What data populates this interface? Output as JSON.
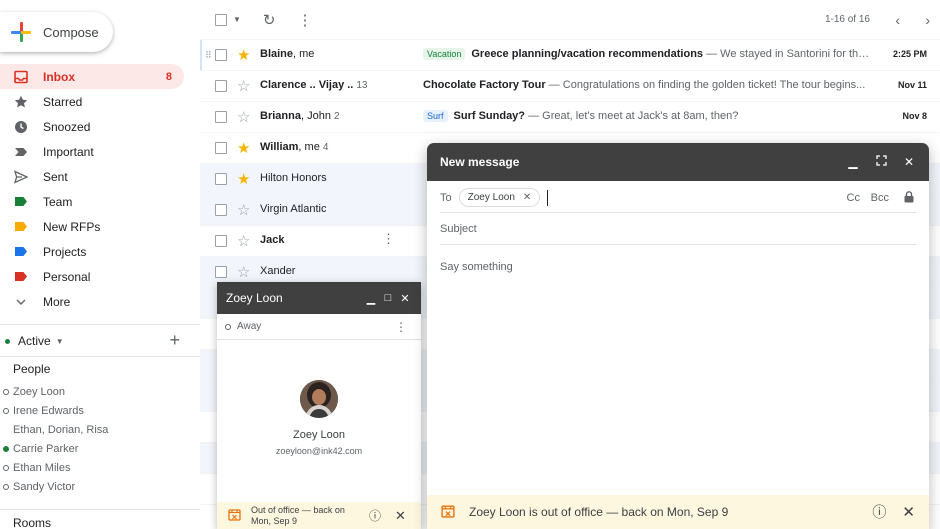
{
  "compose_label": "Compose",
  "nav": [
    {
      "label": "Inbox",
      "count": "8",
      "icon": "inbox-icon",
      "active": true
    },
    {
      "label": "Starred",
      "count": "",
      "icon": "star-icon"
    },
    {
      "label": "Snoozed",
      "count": "",
      "icon": "clock-icon"
    },
    {
      "label": "Important",
      "count": "",
      "icon": "important-icon"
    },
    {
      "label": "Sent",
      "count": "",
      "icon": "send-icon"
    },
    {
      "label": "Team",
      "count": "",
      "icon": "label-icon",
      "color": "#188038"
    },
    {
      "label": "New RFPs",
      "count": "",
      "icon": "label-icon",
      "color": "#f9ab00"
    },
    {
      "label": "Projects",
      "count": "",
      "icon": "label-icon",
      "color": "#1a73e8"
    },
    {
      "label": "Personal",
      "count": "",
      "icon": "label-icon",
      "color": "#d93025"
    },
    {
      "label": "More",
      "count": "",
      "icon": "chevron-down-icon"
    }
  ],
  "active_label": "Active",
  "people_title": "People",
  "people": [
    {
      "name": "Zoey Loon",
      "status": "away"
    },
    {
      "name": "Irene Edwards",
      "status": "away"
    },
    {
      "name": "Ethan, Dorian, Risa",
      "status": "none"
    },
    {
      "name": "Carrie Parker",
      "status": "online"
    },
    {
      "name": "Ethan Miles",
      "status": "away"
    },
    {
      "name": "Sandy Victor",
      "status": "away"
    }
  ],
  "rooms_label": "Rooms",
  "toolbar": {
    "range": "1-16 of 16"
  },
  "emails": [
    {
      "sender": "Blaine",
      "sender_suffix": ", me",
      "count": "",
      "starred": true,
      "unread": true,
      "label": "Vacation",
      "label_bg": "#e6f4ea",
      "label_fg": "#188038",
      "subject": "Greece planning/vacation recommendations",
      "snippet": " — We stayed in Santorini for the...",
      "date": "2:25 PM"
    },
    {
      "sender": "Clarence .. Vijay ..",
      "sender_suffix": "",
      "count": "13",
      "starred": false,
      "unread": true,
      "label": "",
      "subject": "Chocolate Factory Tour",
      "snippet": " — Congratulations on finding the golden ticket! The tour begins...",
      "date": "Nov 11"
    },
    {
      "sender": "Brianna",
      "sender_suffix": ", John",
      "count": "2",
      "starred": false,
      "unread": true,
      "label": "Surf",
      "label_bg": "#e8f0fe",
      "label_fg": "#1967d2",
      "subject": "Surf Sunday?",
      "snippet": " — Great, let's meet at Jack's at 8am, then?",
      "date": "Nov 8"
    },
    {
      "sender": "William",
      "sender_suffix": ", me",
      "count": "4",
      "starred": true,
      "unread": true,
      "label": "",
      "subject": "",
      "snippet": "",
      "date": ""
    },
    {
      "sender": "Hilton Honors",
      "sender_suffix": "",
      "count": "",
      "starred": true,
      "unread": false,
      "label": "",
      "subject": "",
      "snippet": "",
      "date": ""
    },
    {
      "sender": "Virgin Atlantic",
      "sender_suffix": "",
      "count": "",
      "starred": false,
      "unread": false,
      "label": "",
      "subject": "",
      "snippet": "",
      "date": ""
    },
    {
      "sender": "Jack",
      "sender_suffix": "",
      "count": "",
      "starred": false,
      "unread": true,
      "label": "",
      "subject": "",
      "snippet": "",
      "date": "",
      "kebab": true
    },
    {
      "sender": "Xander",
      "sender_suffix": "",
      "count": "",
      "starred": false,
      "unread": false,
      "label": "",
      "subject": "",
      "snippet": "",
      "date": ""
    }
  ],
  "chat": {
    "title": "Zoey Loon",
    "status": "Away",
    "name": "Zoey Loon",
    "email": "zoeyloon@ink42.com",
    "ooo": "Out of office — back on Mon, Sep 9"
  },
  "composer": {
    "title": "New message",
    "to_label": "To",
    "recipient": "Zoey Loon",
    "cc": "Cc",
    "bcc": "Bcc",
    "subject_placeholder": "Subject",
    "body_placeholder": "Say something",
    "ooo": "Zoey Loon is out of office — back on Mon, Sep 9"
  }
}
